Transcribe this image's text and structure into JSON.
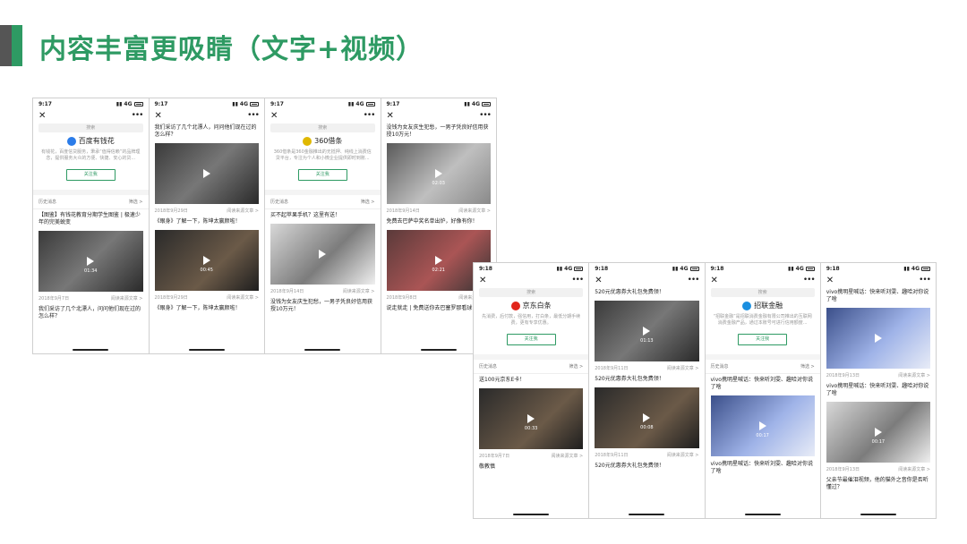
{
  "title": "内容丰富更吸睛（文字+视频）",
  "common": {
    "search": "搜索",
    "follow": "关注我",
    "history": "历史消息",
    "read_source": "阅读来源文章 >",
    "filter": "筛选 >"
  },
  "group1": [
    {
      "time": "9:17",
      "brand": "百度有钱花",
      "brand_color": "#2b7ce9",
      "intro": "有钱花，百度信贷服务，秉承“值得信赖”的品牌理念，提供服务大众的方便、快捷、安心的贷...",
      "articles": [
        {
          "title": "【图鉴】有钱花教育分期学生图鉴 | 极速少年的完美蜕变",
          "date": "2018年9月7日",
          "dur": "01:34",
          "tone": "t-dark"
        },
        {
          "title": "我们采访了几个北漂人，问问他们现在过的怎么样？",
          "date": "",
          "dur": "",
          "tone": ""
        }
      ]
    },
    {
      "time": "9:17",
      "brand": "",
      "brand_color": "",
      "intro": "",
      "articles": [
        {
          "title": "我们采访了几个北漂人，问问他们现在过的怎么样？",
          "date": "2018年9月29日",
          "dur": "",
          "tone": "t-dark"
        },
        {
          "title": "《眼身》了解一下，陈坤太赢颜啦！",
          "date": "2018年9月29日",
          "dur": "00:45",
          "tone": "t-warm"
        },
        {
          "title": "《眼身》了解一下，陈坤太赢颜啦！",
          "date": "",
          "dur": "",
          "tone": ""
        }
      ]
    },
    {
      "time": "9:17",
      "brand": "360借条",
      "brand_color": "#e0b800",
      "intro": "360借条是360金融推出的无抵押、纯线上消费信贷平台，专注为个人和小微企业提供即时到账...",
      "articles": [
        {
          "title": "买不起苹果手机？这里有送！",
          "date": "2018年9月14日",
          "dur": "",
          "tone": "t-light"
        },
        {
          "title": "没钱为女友庆生犯愁，一男子凭良好信用获授10万元！",
          "date": "",
          "dur": "",
          "tone": ""
        }
      ]
    },
    {
      "time": "9:17",
      "brand": "",
      "brand_color": "",
      "intro": "",
      "articles": [
        {
          "title": "没钱为女友庆生犯愁，一男子凭良好信用获授10万元！",
          "date": "2018年9月14日",
          "dur": "02:03",
          "tone": "t-green"
        },
        {
          "title": "免费去巴萨中奖名单出炉，好像有你！",
          "date": "2018年9月8日",
          "dur": "02:21",
          "tone": "t-red"
        },
        {
          "title": "说走就走 | 免费送你去巴塞罗那看球，",
          "date": "",
          "dur": "",
          "tone": ""
        }
      ]
    }
  ],
  "group2": [
    {
      "time": "9:18",
      "brand": "京东白条",
      "brand_color": "#e1251b",
      "intro": "先消费，后付款，强信用，打白条，最低分期手续费，更有专享优惠。",
      "articles": [
        {
          "title": "送100元京东E卡！",
          "date": "2018年9月7日",
          "dur": "00:33",
          "tone": "t-warm"
        },
        {
          "title": "敬教慎",
          "date": "",
          "dur": "",
          "tone": ""
        }
      ]
    },
    {
      "time": "9:18",
      "brand": "",
      "brand_color": "",
      "intro": "",
      "articles": [
        {
          "title": "520元优惠券大礼包免费领！",
          "date": "2018年9月11日",
          "dur": "01:13",
          "tone": "t-dark"
        },
        {
          "title": "520元优惠券大礼包免费领！",
          "date": "2018年9月11日",
          "dur": "00:08",
          "tone": "t-warm"
        },
        {
          "title": "520元优惠券大礼包免费领！",
          "date": "",
          "dur": "",
          "tone": ""
        }
      ]
    },
    {
      "time": "9:18",
      "brand": "招联金融",
      "brand_color": "#1a8fe0",
      "intro": "“招联金融”是招联消费金融有限公司推出的互联网消费金融产品，通过本账号可进行信用额度...",
      "articles": [
        {
          "title": "vivo携明星喊话：快来听刘雯、趣哈对你说了啥",
          "date": "",
          "dur": "00:17",
          "tone": "t-blue"
        },
        {
          "title": "vivo携明星喊话：快来听刘雯、趣哈对你说了啥",
          "date": "",
          "dur": "",
          "tone": ""
        }
      ]
    },
    {
      "time": "9:18",
      "brand": "",
      "brand_color": "",
      "intro": "",
      "articles": [
        {
          "title": "vivo携明星喊话：快来听刘雯、趣哈对你说了啥",
          "date": "2018年9月13日",
          "dur": "",
          "tone": "t-blue"
        },
        {
          "title": "vivo携明星喊话：快来听刘雯、趣哈对你说了啥",
          "date": "2018年9月13日",
          "dur": "00:17",
          "tone": "t-light"
        },
        {
          "title": "父亲节最催泪视频，他的猫外之音你是否听懂过？",
          "date": "",
          "dur": "",
          "tone": ""
        }
      ]
    }
  ]
}
